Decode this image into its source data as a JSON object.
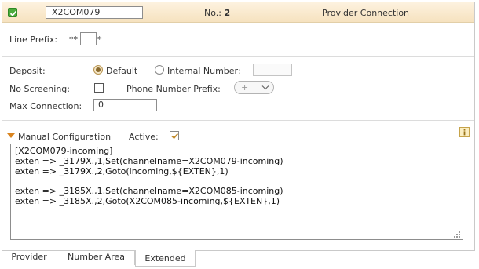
{
  "header": {
    "trunk_name": "X2COM079",
    "number_label": "No.:",
    "number_value": "2",
    "type": "Provider Connection"
  },
  "line_prefix": {
    "label": "Line Prefix:",
    "before": "**",
    "value": "",
    "after": "*"
  },
  "deposit": {
    "label": "Deposit:",
    "default_label": "Default",
    "internal_label": "Internal Number:",
    "internal_value": "",
    "selected": "Default"
  },
  "no_screening": {
    "label": "No Screening:",
    "checked": false
  },
  "phone_prefix": {
    "label": "Phone Number Prefix:",
    "value": "+"
  },
  "max_connection": {
    "label": "Max Connection:",
    "value": "0"
  },
  "manual_config": {
    "label": "Manual Configuration",
    "active_label": "Active:",
    "active": true,
    "lines": [
      "[X2COM079-incoming]",
      "exten => _3179X.,1,Set(channelname=X2COM079-incoming)",
      "exten => _3179X.,2,Goto(incoming,${EXTEN},1)",
      "",
      "exten => _3185X.,1,Set(channelname=X2COM085-incoming)",
      "exten => _3185X.,2,Goto(X2COM085-incoming,${EXTEN},1)"
    ]
  },
  "tabs": [
    {
      "label": "Provider",
      "selected": false
    },
    {
      "label": "Number Area",
      "selected": false
    },
    {
      "label": "Extended",
      "selected": true
    }
  ],
  "colors": {
    "header_bg": "#f6e2bf",
    "enabled_check": "#4bab3d",
    "accent": "#d9841f"
  },
  "icons": {
    "enabled": "check-icon",
    "collapse": "triangle-down-icon",
    "info": "info-icon",
    "resize": "resize-grip-icon",
    "dropdown": "chevron-down-icon"
  }
}
